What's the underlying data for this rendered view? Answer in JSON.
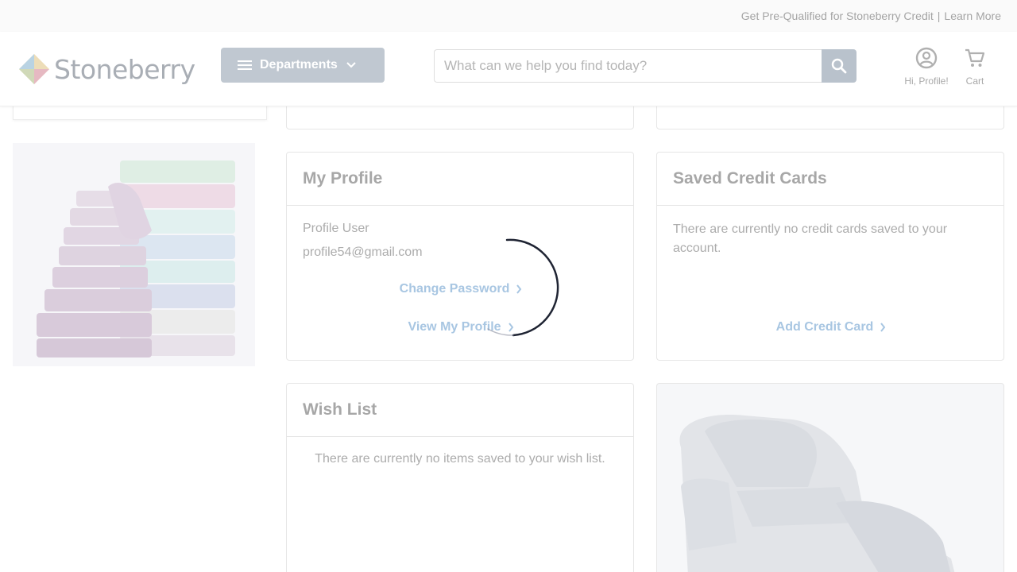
{
  "promo_bar": {
    "text": "Get Pre-Qualified for Stoneberry Credit",
    "separator": "|",
    "link": "Learn More"
  },
  "header": {
    "logo_text": "Stoneberry",
    "departments_label": "Departments",
    "search_placeholder": "What can we help you find today?",
    "account_label": "Hi, Profile!",
    "cart_label": "Cart"
  },
  "profile_card": {
    "title": "My Profile",
    "name": "Profile User",
    "email": "profile54@gmail.com",
    "change_password": "Change Password",
    "view_profile": "View My Profile"
  },
  "credit_card": {
    "title": "Saved Credit Cards",
    "empty_text": "There are currently no credit cards saved to your account.",
    "add_link": "Add Credit Card"
  },
  "wish_card": {
    "title": "Wish List",
    "empty_text": "There are currently no items saved to your wish list."
  },
  "icons": {
    "menu": "hamburger-menu-icon",
    "chevron": "chevron-down-icon",
    "search": "search-icon",
    "account": "account-circle-icon",
    "cart": "shopping-cart-icon",
    "link_arrow": "chevron-right-icon",
    "loading": "loading-spinner-icon"
  },
  "colors": {
    "accent_link": "#a8c6e2",
    "button_bg": "#c0c8d1",
    "text_muted": "#acacac"
  }
}
